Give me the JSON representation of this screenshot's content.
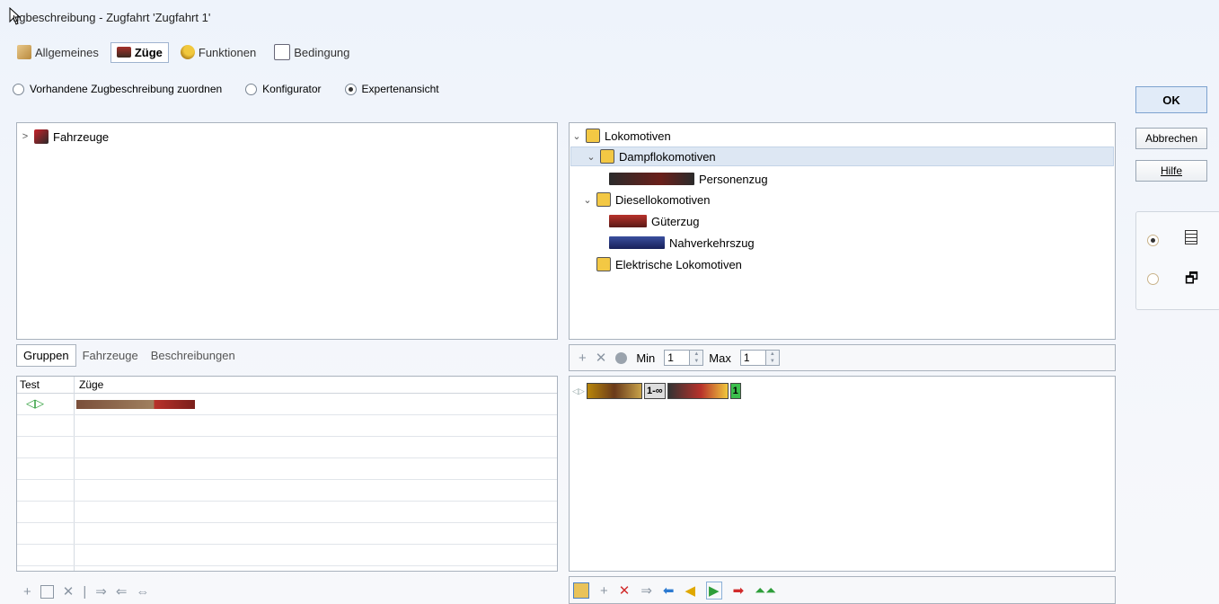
{
  "window": {
    "title": "ugbeschreibung - Zugfahrt 'Zugfahrt 1'"
  },
  "tabs": [
    {
      "label": "Allgemeines",
      "icon": "settings-icon"
    },
    {
      "label": "Züge",
      "icon": "train-icon"
    },
    {
      "label": "Funktionen",
      "icon": "key-icon"
    },
    {
      "label": "Bedingung",
      "icon": "condition-icon"
    }
  ],
  "mode_radios": [
    {
      "label": "Vorhandene Zugbeschreibung zuordnen",
      "selected": false
    },
    {
      "label": "Konfigurator",
      "selected": false
    },
    {
      "label": "Expertenansicht",
      "selected": true
    }
  ],
  "left_tree": {
    "root": "Fahrzeuge"
  },
  "right_tree": {
    "root": "Lokomotiven",
    "groups": [
      {
        "label": "Dampflokomotiven",
        "items": [
          "Personenzug"
        ]
      },
      {
        "label": "Diesellokomotiven",
        "items": [
          "Güterzug",
          "Nahverkehrszug"
        ]
      },
      {
        "label": "Elektrische Lokomotiven",
        "items": []
      }
    ]
  },
  "lower_tabs": [
    "Gruppen",
    "Fahrzeuge",
    "Beschreibungen"
  ],
  "grid": {
    "columns": [
      "Test",
      "Züge"
    ]
  },
  "minmax": {
    "min_label": "Min",
    "min_value": "1",
    "max_label": "Max",
    "max_value": "1"
  },
  "composition": {
    "range_label": "1-∞",
    "count_label": "1"
  },
  "buttons": {
    "ok": "OK",
    "cancel": "Abbrechen",
    "help": "Hilfe"
  },
  "colors": {
    "accent": "#4a7fc1",
    "selection": "#dde7f3",
    "delete_red": "#d12b2b",
    "green": "#2e9e3a"
  }
}
